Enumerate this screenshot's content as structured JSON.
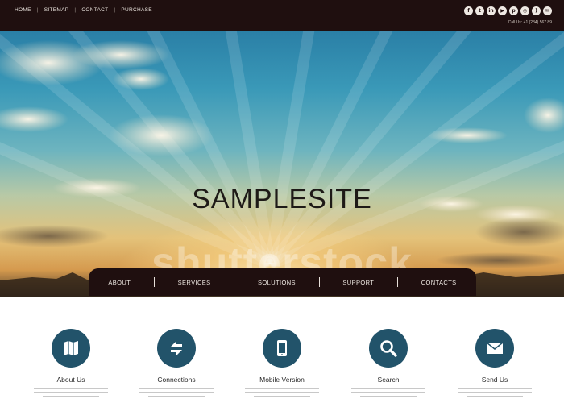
{
  "top_nav": {
    "links": [
      "HOME",
      "SITEMAP",
      "CONTACT",
      "PURCHASE"
    ],
    "social_icons": [
      "facebook-icon",
      "twitter-icon",
      "linkedin-icon",
      "youtube-icon",
      "pinterest-icon",
      "instagram-icon",
      "rss-icon",
      "email-icon"
    ],
    "call_us": "Call Us: +1 (234) 567 89"
  },
  "hero": {
    "title": "SAMPLESITE",
    "watermark": "shutterstock"
  },
  "main_nav": {
    "items": [
      "ABOUT",
      "SERVICES",
      "SOLUTIONS",
      "SUPPORT",
      "CONTACTS"
    ]
  },
  "features": [
    {
      "title": "About Us",
      "icon": "map-icon"
    },
    {
      "title": "Connections",
      "icon": "connections-icon"
    },
    {
      "title": "Mobile Version",
      "icon": "tablet-icon"
    },
    {
      "title": "Search",
      "icon": "search-icon"
    },
    {
      "title": "Send Us",
      "icon": "envelope-icon"
    }
  ],
  "colors": {
    "dark_bar": "#1f0f0f",
    "feature_circle": "#22536a",
    "sky_top": "#2a7fa6",
    "sun_glow": "#fff4c8"
  }
}
